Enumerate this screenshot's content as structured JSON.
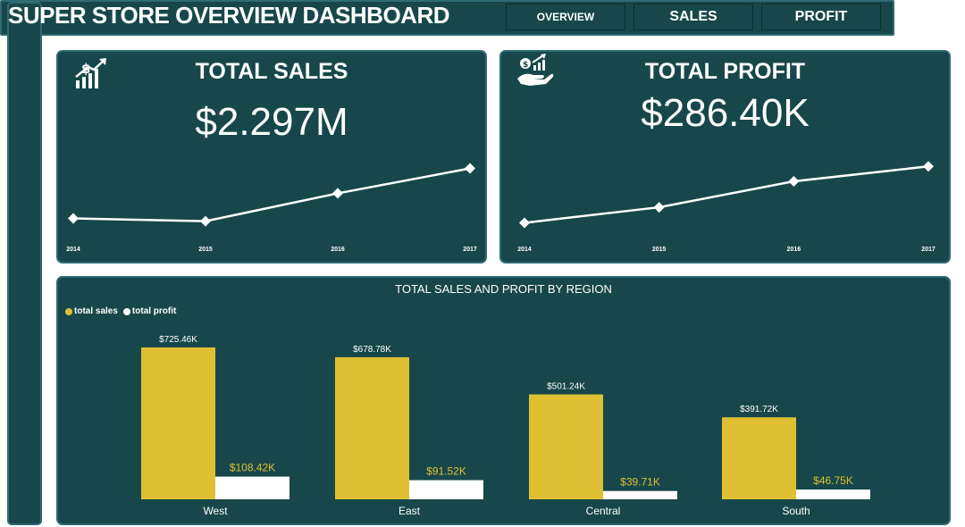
{
  "header": {
    "title": "SUPER STORE OVERVIEW DASHBOARD",
    "nav": [
      {
        "label": "OVERVIEW"
      },
      {
        "label": "SALES"
      },
      {
        "label": "PROFIT"
      }
    ]
  },
  "cards": {
    "sales": {
      "title": "TOTAL SALES",
      "value": "$2.297M",
      "icon": "sales-growth-icon"
    },
    "profit": {
      "title": "TOTAL PROFIT",
      "value": "$286.40K",
      "icon": "profit-money-hand-icon"
    }
  },
  "region": {
    "title": "TOTAL SALES AND PROFIT BY REGION",
    "legend": [
      "total sales",
      "total profit"
    ]
  },
  "colors": {
    "panel": "#17474a",
    "border": "#2e6b73",
    "sales_bar": "#dfc033",
    "profit_bar": "#ffffff"
  },
  "chart_data": [
    {
      "type": "line",
      "title": "TOTAL SALES",
      "x": [
        "2014",
        "2015",
        "2016",
        "2017"
      ],
      "series": [
        {
          "values": [
            484247,
            470533,
            609206,
            733215
          ]
        }
      ]
    },
    {
      "type": "line",
      "title": "TOTAL PROFIT",
      "x": [
        "2014",
        "2015",
        "2016",
        "2017"
      ],
      "series": [
        {
          "values": [
            49544,
            61619,
            81795,
            93439
          ]
        }
      ]
    },
    {
      "type": "bar",
      "title": "TOTAL SALES AND PROFIT BY REGION",
      "categories": [
        "West",
        "East",
        "Central",
        "South"
      ],
      "series": [
        {
          "name": "total sales",
          "values": [
            725.46,
            678.78,
            501.24,
            391.72
          ],
          "labels": [
            "$725.46K",
            "$678.78K",
            "$501.24K",
            "$391.72K"
          ]
        },
        {
          "name": "total profit",
          "values": [
            108.42,
            91.52,
            39.71,
            46.75
          ],
          "labels": [
            "$108.42K",
            "$91.52K",
            "$39.71K",
            "$46.75K"
          ]
        }
      ],
      "ylim": [
        0,
        760
      ]
    }
  ]
}
